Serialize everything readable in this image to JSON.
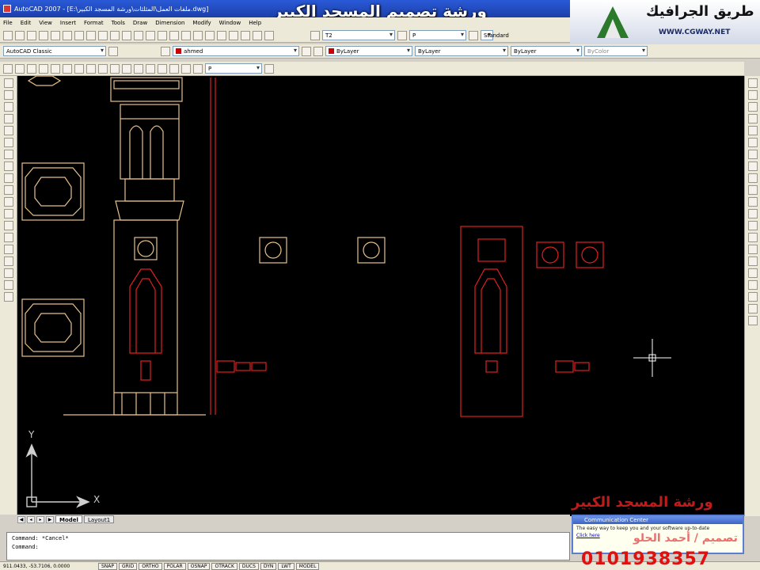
{
  "window": {
    "title": "AutoCAD 2007 - [E:\\ملفات العمل\\المثلثات\\ورشة المسجد الكبير.dwg]"
  },
  "banner": {
    "text": "ورشة تصميم المسجد الكبير"
  },
  "logo": {
    "text": "طريق الجرافيك",
    "url": "WWW.CGWAY.NET"
  },
  "menu": {
    "items": [
      "File",
      "Edit",
      "View",
      "Insert",
      "Format",
      "Tools",
      "Draw",
      "Dimension",
      "Modify",
      "Window",
      "Help"
    ]
  },
  "toolbars": {
    "text_style": "T2",
    "dim_style": "P",
    "workspace": "AutoCAD Classic",
    "layer": "ahmed",
    "color": "ByLayer",
    "linetype": "ByLayer",
    "lineweight": "ByLayer",
    "plotstyle": "ByColor",
    "standard_label": "Standard",
    "layer_filter": "P"
  },
  "tabs": {
    "model": "Model",
    "layout": "Layout1"
  },
  "command": {
    "line1": "Command: *Cancel*",
    "line2": "Command:"
  },
  "status": {
    "coords": "911.0433, -53.7106, 0.0000",
    "buttons": [
      "SNAP",
      "GRID",
      "ORTHO",
      "POLAR",
      "OSNAP",
      "OTRACK",
      "DUCS",
      "DYN",
      "LWT",
      "MODEL"
    ]
  },
  "comm_center": {
    "title": "Communication Center",
    "body": "The easy way to keep you and your software up-to-date",
    "link": "Click here"
  },
  "ucs": {
    "y": "Y",
    "x": "X"
  },
  "watermark": {
    "workshop": "ورشة المسجد الكبير",
    "designer": "تصميم / أحمد الحلو",
    "phone": "0101938357"
  },
  "colors": {
    "canvas": "#000000",
    "drawing_tan": "#e6c08a",
    "drawing_red": "#e02020"
  }
}
